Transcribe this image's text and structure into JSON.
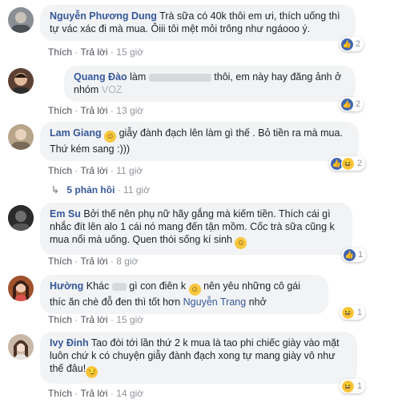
{
  "labels": {
    "like": "Thích",
    "reply": "Trả lời",
    "sep": "·"
  },
  "comments": [
    {
      "author": "Nguyễn Phương Dung",
      "text": "Trà sữa có 40k thôi em ưi, thích uống thì tự vác xác đi mà mua. Ôiii tôi mệt mỏi trông như ngáooo ý.",
      "time": "15 giờ",
      "reaction_count": "2",
      "avatar_color": "#8a8f96"
    },
    {
      "author": "Quang Đào",
      "text_start": "làm",
      "text_mid": "thôi, em này hay đăng ảnh ở nhóm",
      "text_end": "VOZ",
      "time": "13 giờ",
      "reaction_count": "2",
      "avatar_color": "#5c4033"
    },
    {
      "author": "Lam Giang",
      "text": "giẫy đành đạch lên làm gì thế . Bỏ tiền ra mà mua. Thứ kém sang :)))",
      "time": "11 giờ",
      "reaction_count": "2",
      "avatar_color": "#b9a58a",
      "replies_label": "5 phản hồi",
      "replies_time": "11 giờ"
    },
    {
      "author": "Em Su",
      "text": "Bởi thế nên phụ nữ hãy gắng mà kiếm tiền. Thích cái gì nhắc đít lên alo 1 cái nó mang đến tận mồm. Cốc trà sữa cũng k mua nổi mà uống. Quen thói sống kí sinh",
      "time": "8 giờ",
      "reaction_count": "1",
      "avatar_color": "#3a3a3a"
    },
    {
      "author": "Hường",
      "text_start": "Khác",
      "text_mid": "gì con điên k",
      "text_end": "nên yêu những cô gái thíc ăn chè đỗ đen thì tốt hơn",
      "tagged": "Nguyễn Trang",
      "text_tail": "nhở",
      "time": "15 giờ",
      "reaction_count": "1",
      "avatar_color": "#a0522d"
    },
    {
      "author": "Ivy Đinh",
      "text": "Tao đòi tới lần thứ 2 k mua là tao phi chiếc giày vào mặt luôn chứ k có chuyện giẫy đành đạch xong tự mang giày vô như thế đâu!",
      "time": "14 giờ",
      "reaction_count": "1",
      "avatar_color": "#c9b7a8"
    }
  ]
}
